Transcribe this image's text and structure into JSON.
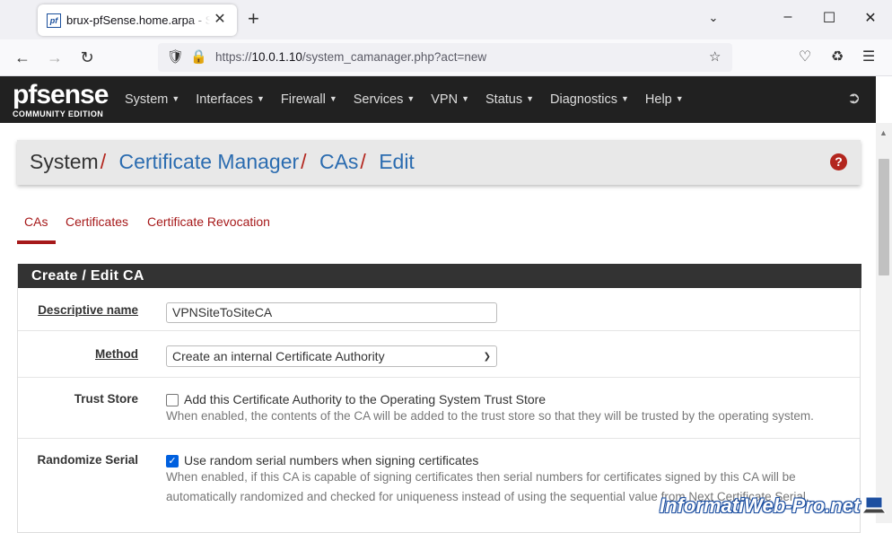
{
  "browser": {
    "tab_title": "brux-pfSense.home.arpa - System",
    "favicon_text": "pf",
    "url_prefix": "https://",
    "url_host": "10.0.1.10",
    "url_path": "/system_camanager.php?act=new"
  },
  "pfsense": {
    "logo_pf": "pf",
    "logo_sense": "sense",
    "logo_sub": "COMMUNITY EDITION",
    "menu": [
      "System",
      "Interfaces",
      "Firewall",
      "Services",
      "VPN",
      "Status",
      "Diagnostics",
      "Help"
    ]
  },
  "breadcrumb": {
    "root": "System",
    "items": [
      "Certificate Manager",
      "CAs",
      "Edit"
    ],
    "sep": "/"
  },
  "tabs": [
    "CAs",
    "Certificates",
    "Certificate Revocation"
  ],
  "panel": {
    "title": "Create / Edit CA",
    "descriptive_name_label": "Descriptive name",
    "descriptive_name_value": "VPNSiteToSiteCA",
    "method_label": "Method",
    "method_value": "Create an internal Certificate Authority",
    "trust_store_label": "Trust Store",
    "trust_store_checkbox": "Add this Certificate Authority to the Operating System Trust Store",
    "trust_store_checked": false,
    "trust_store_help": "When enabled, the contents of the CA will be added to the trust store so that they will be trusted by the operating system.",
    "randomize_label": "Randomize Serial",
    "randomize_checkbox": "Use random serial numbers when signing certificates",
    "randomize_checked": true,
    "randomize_help_1": "When enabled, if this CA is capable of signing certificates then serial numbers for certificates signed by this CA will be",
    "randomize_help_2": "automatically randomized and checked for uniqueness instead of using the sequential value from Next Certificate Serial."
  },
  "watermark": "InformatiWeb-Pro.net"
}
